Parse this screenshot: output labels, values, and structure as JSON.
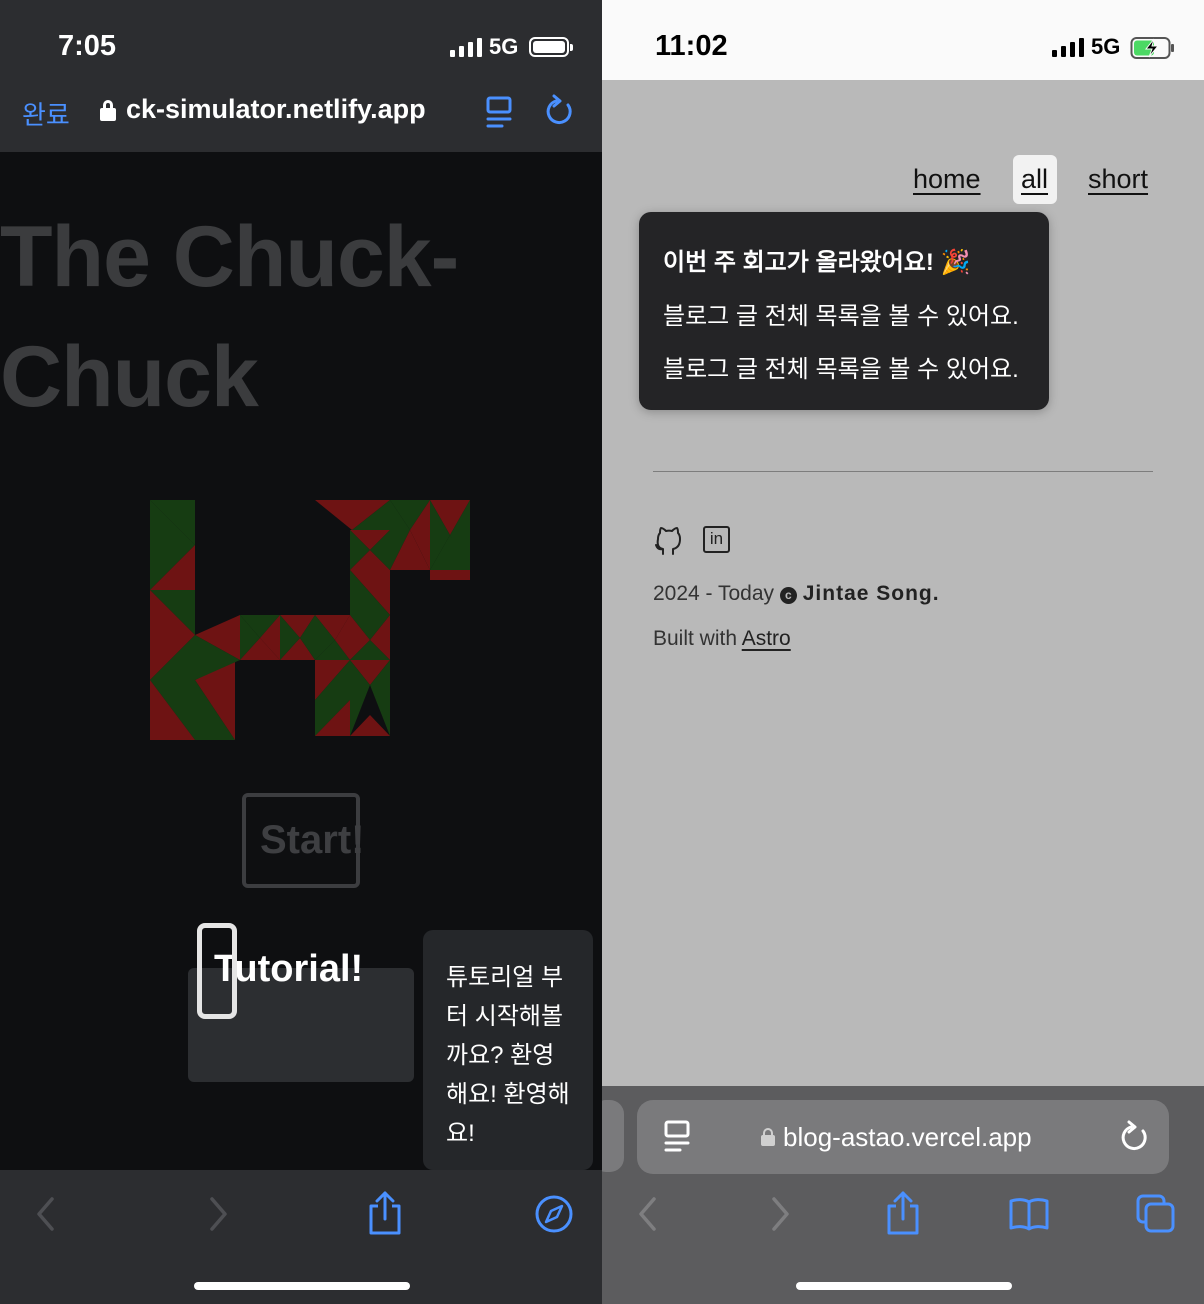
{
  "left": {
    "status": {
      "time": "7:05",
      "network": "5G"
    },
    "browser": {
      "done_label": "완료",
      "domain": "ck-simulator.netlify.app"
    },
    "page": {
      "title_line1": "The Chuck-",
      "title_line2": "Chuck",
      "start_label": "Start!",
      "tutorial_label": "Tutorial!",
      "tutorial_tip": "튜토리얼 부터 시작해볼까요? 환영해요! 환영해요!"
    },
    "toolbar": [
      "back-icon",
      "forward-icon",
      "share-icon",
      "compass-icon"
    ]
  },
  "right": {
    "status": {
      "time": "11:02",
      "network": "5G",
      "battery_charging": true
    },
    "nav": {
      "home": "home",
      "all": "all",
      "short": "short"
    },
    "popover": {
      "heading": "이번 주 회고가 올라왔어요! 🎉",
      "line1": "블로그 글 전체 목록을 볼 수 있어요.",
      "line2": "블로그 글 전체 목록을 볼 수 있어요."
    },
    "footer": {
      "years": "2024 - Today",
      "author": "Jintae Song.",
      "built_with": "Built with",
      "built_link": "Astro"
    },
    "browser": {
      "domain": "blog-astao.vercel.app"
    },
    "toolbar": [
      "back-icon",
      "forward-icon",
      "share-icon",
      "bookmarks-icon",
      "tabs-icon"
    ]
  },
  "colors": {
    "accent_blue": "#4a90ff",
    "snake_red": "#6e1313",
    "snake_green": "#163c12",
    "battery_green": "#4cd964"
  }
}
